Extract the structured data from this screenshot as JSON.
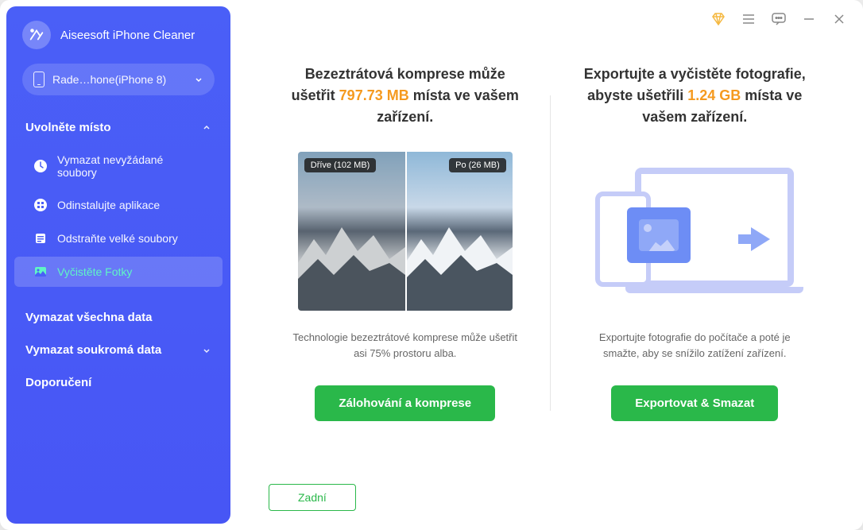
{
  "app": {
    "title": "Aiseesoft iPhone Cleaner"
  },
  "device": {
    "label": "Rade…hone(iPhone 8)"
  },
  "sidebar": {
    "section_free_space": "Uvolněte místo",
    "items": [
      {
        "label": "Vymazat nevyžádané soubory"
      },
      {
        "label": "Odinstalujte aplikace"
      },
      {
        "label": "Odstraňte velké soubory"
      },
      {
        "label": "Vyčistěte Fotky"
      }
    ],
    "erase_all": "Vymazat všechna data",
    "erase_private": "Vymazat soukromá data",
    "recommend": "Doporučení"
  },
  "compress": {
    "headline_pre": "Bezeztrátová komprese může ušetřit ",
    "headline_accent": "797.73 MB",
    "headline_post": " místa ve vašem zařízení.",
    "tag_before": "Dříve (102 MB)",
    "tag_after": "Po (26 MB)",
    "desc": "Technologie bezeztrátové komprese může ušetřit asi 75% prostoru alba.",
    "button": "Zálohování a komprese"
  },
  "export": {
    "headline_pre": "Exportujte a vyčistěte fotografie, abyste ušetřili ",
    "headline_accent": "1.24 GB",
    "headline_post": " místa ve vašem zařízení.",
    "desc": "Exportujte fotografie do počítače a poté je smažte, aby se snížilo zatížení zařízení.",
    "button": "Exportovat & Smazat"
  },
  "back": "Zadní"
}
